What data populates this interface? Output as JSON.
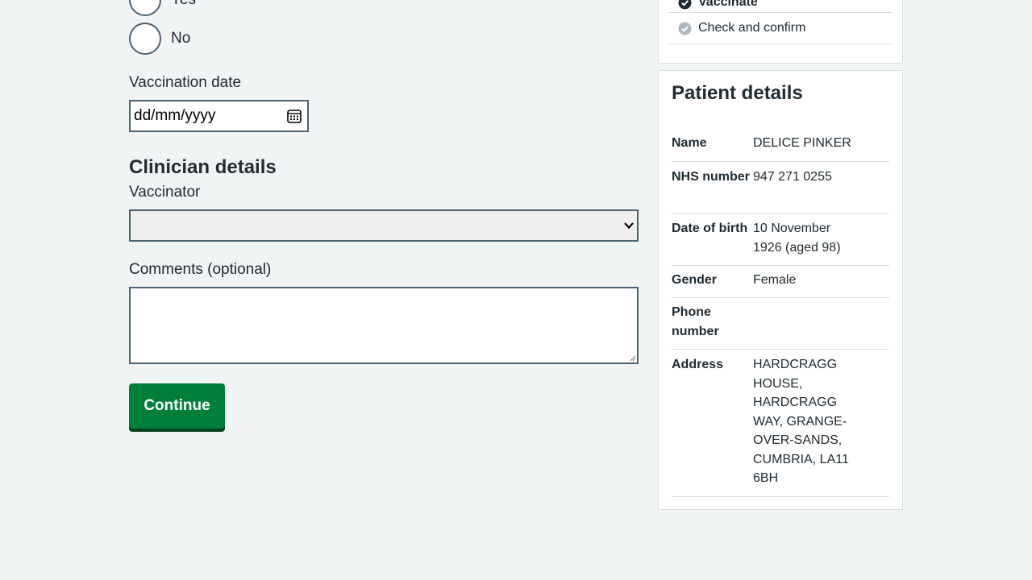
{
  "form": {
    "radio_options": [
      {
        "label": "Yes",
        "selected": false
      },
      {
        "label": "No",
        "selected": false
      }
    ],
    "vaccination_date": {
      "label": "Vaccination date",
      "placeholder": "dd/mm/yyyy",
      "value": ""
    },
    "clinician_heading": "Clinician details",
    "vaccinator": {
      "label": "Vaccinator",
      "selected_value": ""
    },
    "comments": {
      "label": "Comments (optional)",
      "value": ""
    },
    "continue_label": "Continue"
  },
  "task_list": {
    "items": [
      {
        "label": "Vaccinate",
        "status": "done",
        "icon": "check-circle-icon"
      },
      {
        "label": "Check and confirm",
        "status": "pending",
        "icon": "check-circle-icon"
      }
    ]
  },
  "patient": {
    "title": "Patient details",
    "rows": [
      {
        "key": "Name",
        "value": "DELICE PINKER"
      },
      {
        "key": "NHS number",
        "value": "947 271 0255"
      },
      {
        "key": "Date of birth",
        "value": "10 November 1926 (aged 98)"
      },
      {
        "key": "Gender",
        "value": "Female"
      },
      {
        "key": "Phone number",
        "value": ""
      },
      {
        "key": "Address",
        "value": "HARDCRAGG HOUSE, HARDCRAGG WAY, GRANGE-OVER-SANDS, CUMBRIA, LA11 6BH"
      }
    ]
  },
  "colors": {
    "background": "#f0f4f5",
    "primary_button": "#007f3b",
    "input_border": "#4c6272",
    "text": "#212b32"
  }
}
